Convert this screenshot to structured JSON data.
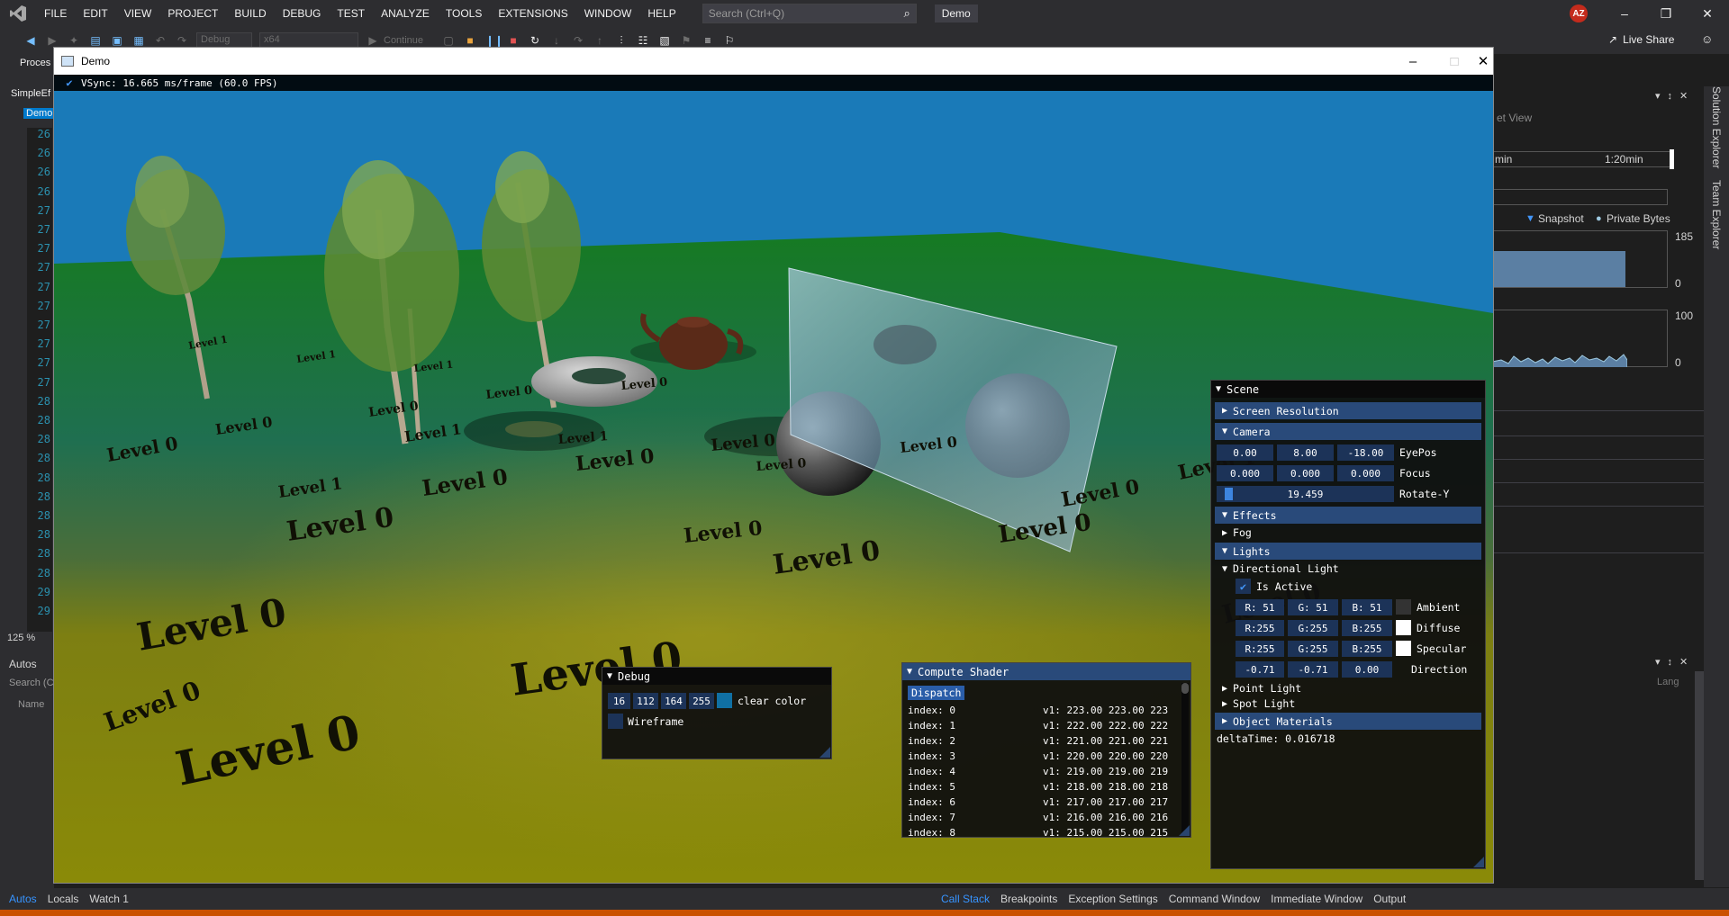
{
  "vs": {
    "menu": [
      "FILE",
      "EDIT",
      "VIEW",
      "PROJECT",
      "BUILD",
      "DEBUG",
      "TEST",
      "ANALYZE",
      "TOOLS",
      "EXTENSIONS",
      "WINDOW",
      "HELP"
    ],
    "search_placeholder": "Search (Ctrl+Q)",
    "solution_name": "Demo",
    "avatar_initials": "AZ",
    "toolbar": {
      "config": "Debug",
      "platform": "x64",
      "continue": "Continue"
    },
    "live_share": "Live Share",
    "left": {
      "process_label": "Proces",
      "tab_file": "SimpleEf",
      "tab_demo": "Demo",
      "line_numbers": [
        "26",
        "26",
        "26",
        "26",
        "27",
        "27",
        "27",
        "27",
        "27",
        "27",
        "27",
        "27",
        "27",
        "27",
        "28",
        "28",
        "28",
        "28",
        "28",
        "28",
        "28",
        "28",
        "28",
        "28",
        "29",
        "29"
      ],
      "zoom": "125 %",
      "autos_title": "Autos",
      "autos_search": "Search (C",
      "autos_col_name": "Name"
    },
    "right_panel": {
      "view_label": "et View",
      "timeline_left": "min",
      "timeline_right": "1:20min",
      "legend_snapshot": "Snapshot",
      "legend_private": "Private Bytes",
      "chart1_max": "185",
      "chart1_min": "0",
      "chart2_max": "100",
      "chart2_min": "0",
      "lang_label": "Lang"
    },
    "vertical_tabs": [
      "Solution Explorer",
      "Team Explorer"
    ],
    "bottom_tabs_left": [
      "Autos",
      "Locals",
      "Watch 1"
    ],
    "bottom_tabs_right": [
      "Call Stack",
      "Breakpoints",
      "Exception Settings",
      "Command Window",
      "Immediate Window",
      "Output"
    ]
  },
  "demo": {
    "window_title": "Demo",
    "vsync_text": "VSync: 16.665 ms/frame (60.0 FPS)",
    "ground_label": "Level 0",
    "ground_label_far": "Level 1",
    "colors": {
      "sky": "#1a7ab8",
      "ground_near": "#8a8a10",
      "ground_far": "#1a7a1a",
      "imgui_header": "#294a7a",
      "imgui_frame": "#1c3358",
      "check": "#4296fa"
    }
  },
  "debug_panel": {
    "title": "Debug",
    "clear_color": [
      "16",
      "112",
      "164",
      "255"
    ],
    "clear_color_label": "clear color",
    "wireframe_label": "Wireframe"
  },
  "compute_panel": {
    "title": "Compute Shader",
    "dispatch": "Dispatch",
    "rows": [
      {
        "index": "index: 0",
        "v1": "v1: 223.00 223.00 223"
      },
      {
        "index": "index: 1",
        "v1": "v1: 222.00 222.00 222"
      },
      {
        "index": "index: 2",
        "v1": "v1: 221.00 221.00 221"
      },
      {
        "index": "index: 3",
        "v1": "v1: 220.00 220.00 220"
      },
      {
        "index": "index: 4",
        "v1": "v1: 219.00 219.00 219"
      },
      {
        "index": "index: 5",
        "v1": "v1: 218.00 218.00 218"
      },
      {
        "index": "index: 6",
        "v1": "v1: 217.00 217.00 217"
      },
      {
        "index": "index: 7",
        "v1": "v1: 216.00 216.00 216"
      },
      {
        "index": "index: 8",
        "v1": "v1: 215.00 215.00 215"
      }
    ]
  },
  "scene_panel": {
    "title": "Scene",
    "screen_resolution": "Screen Resolution",
    "camera": "Camera",
    "eyepos": {
      "values": [
        "0.00",
        "8.00",
        "-18.00"
      ],
      "label": "EyePos"
    },
    "focus": {
      "values": [
        "0.000",
        "0.000",
        "0.000"
      ],
      "label": "Focus"
    },
    "rotate_y": {
      "value": "19.459",
      "label": "Rotate-Y",
      "fraction": 0.027
    },
    "effects": "Effects",
    "fog": "Fog",
    "lights": "Lights",
    "directional_light": "Directional Light",
    "is_active": "Is Active",
    "ambient": {
      "values": [
        "R: 51",
        "G: 51",
        "B: 51"
      ],
      "label": "Ambient",
      "swatch": "#333333"
    },
    "diffuse": {
      "values": [
        "R:255",
        "G:255",
        "B:255"
      ],
      "label": "Diffuse",
      "swatch": "#ffffff"
    },
    "specular": {
      "values": [
        "R:255",
        "G:255",
        "B:255"
      ],
      "label": "Specular",
      "swatch": "#ffffff"
    },
    "direction": {
      "values": [
        "-0.71",
        "-0.71",
        "0.00"
      ],
      "label": "Direction"
    },
    "point_light": "Point Light",
    "spot_light": "Spot Light",
    "object_materials": "Object Materials",
    "delta_time": "deltaTime: 0.016718"
  }
}
